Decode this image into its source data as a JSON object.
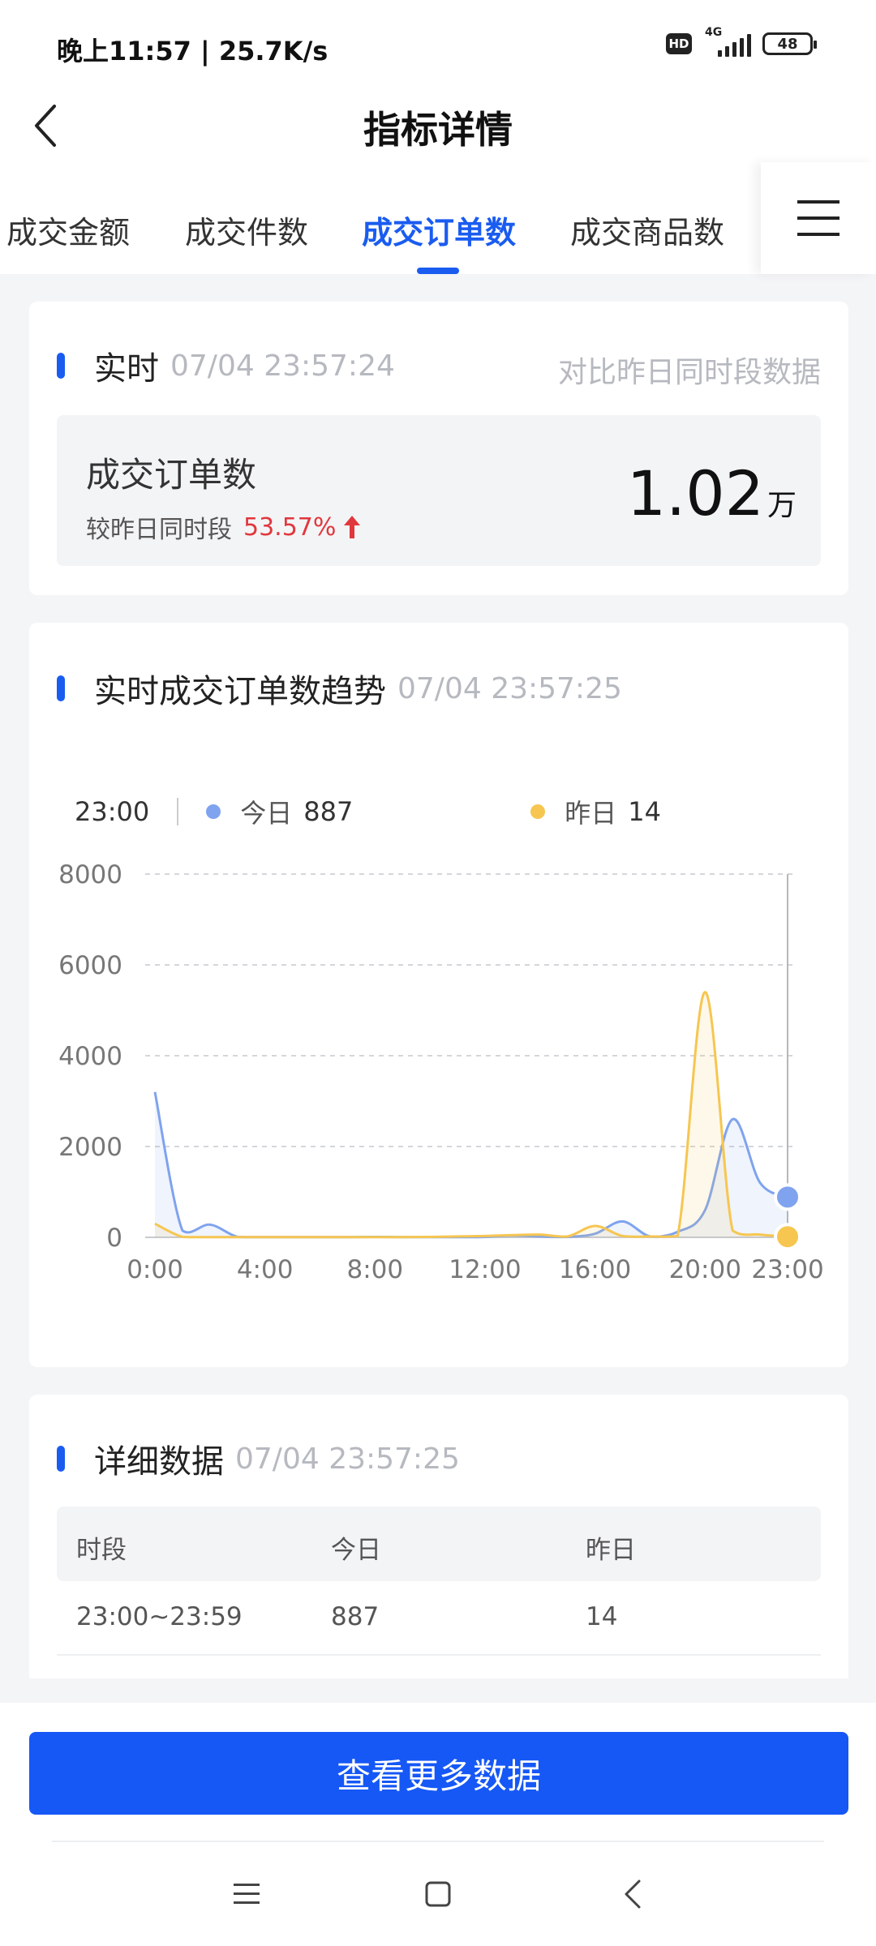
{
  "status_bar": {
    "time": "晚上11:57 | 25.7K/s",
    "hd_badge": "HD",
    "network": "4G",
    "battery": "48"
  },
  "header": {
    "title": "指标详情"
  },
  "tabs": [
    {
      "label": "成交金额",
      "active": false
    },
    {
      "label": "成交件数",
      "active": false
    },
    {
      "label": "成交订单数",
      "active": true
    },
    {
      "label": "成交商品数",
      "active": false
    }
  ],
  "realtime": {
    "title": "实时",
    "time": "07/04 23:57:24",
    "compare_note": "对比昨日同时段数据",
    "metric_label": "成交订单数",
    "compare_label": "较昨日同时段",
    "compare_pct": "53.57%",
    "value": "1.02",
    "unit": "万"
  },
  "trend": {
    "title": "实时成交订单数趋势",
    "time": "07/04 23:57:25",
    "legend_time": "23:00",
    "legend_today_label": "今日",
    "legend_today_value": "887",
    "legend_yesterday_label": "昨日",
    "legend_yesterday_value": "14"
  },
  "chart_data": {
    "type": "line",
    "x": [
      "0:00",
      "1:00",
      "2:00",
      "3:00",
      "4:00",
      "5:00",
      "6:00",
      "7:00",
      "8:00",
      "9:00",
      "10:00",
      "11:00",
      "12:00",
      "13:00",
      "14:00",
      "15:00",
      "16:00",
      "17:00",
      "18:00",
      "19:00",
      "20:00",
      "21:00",
      "22:00",
      "23:00"
    ],
    "tick_labels": [
      "0:00",
      "4:00",
      "8:00",
      "12:00",
      "16:00",
      "20:00",
      "23:00"
    ],
    "tick_positions": [
      0,
      4,
      8,
      12,
      16,
      20,
      23
    ],
    "series": [
      {
        "name": "今日",
        "color": "#7fa3ee",
        "values": [
          3200,
          150,
          280,
          10,
          5,
          5,
          5,
          5,
          10,
          5,
          5,
          5,
          10,
          40,
          20,
          10,
          80,
          350,
          20,
          120,
          600,
          2600,
          1200,
          887
        ]
      },
      {
        "name": "昨日",
        "color": "#f6c651",
        "values": [
          300,
          10,
          5,
          5,
          5,
          5,
          5,
          5,
          5,
          5,
          10,
          20,
          30,
          50,
          60,
          20,
          250,
          30,
          20,
          30,
          5400,
          150,
          60,
          14
        ]
      }
    ],
    "y_ticks": [
      0,
      2000,
      4000,
      6000,
      8000
    ],
    "ylim": [
      0,
      8000
    ],
    "grid": true,
    "highlight_index": 23
  },
  "details": {
    "title": "详细数据",
    "time": "07/04 23:57:25",
    "columns": [
      "时段",
      "今日",
      "昨日"
    ],
    "rows": [
      [
        "23:00~23:59",
        "887",
        "14"
      ]
    ]
  },
  "bottom": {
    "more_button": "查看更多数据"
  },
  "colors": {
    "accent": "#1a5cf0",
    "up": "#e0373d",
    "today": "#7fa3ee",
    "yesterday": "#f6c651"
  }
}
